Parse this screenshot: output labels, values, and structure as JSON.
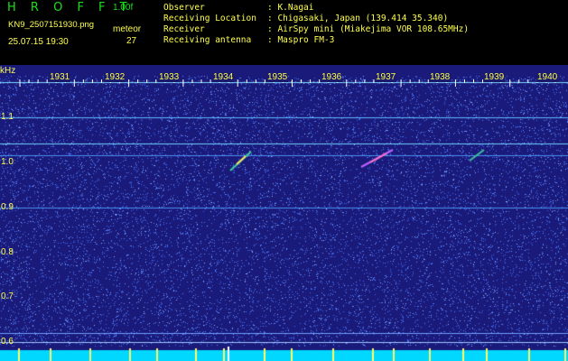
{
  "header": {
    "title": "H R O F F T",
    "version": "1.00f",
    "filename": "KN9_2507151930.png",
    "timestamp": "25.07.15 19:30",
    "meteor_label": "meteor",
    "meteor_count": "27",
    "info": [
      {
        "label": "Observer",
        "value": ": K.Nagai"
      },
      {
        "label": "Receiving Location",
        "value": ": Chigasaki, Japan (139.414 35.340)"
      },
      {
        "label": "Receiver",
        "value": ": AirSpy mini (Miakejima VOR 108.65MHz)"
      },
      {
        "label": "Receiving antenna",
        "value": ": Maspro FM-3"
      }
    ]
  },
  "axis": {
    "unit": "kHz",
    "y_ticks": [
      "1.1",
      "1.0",
      "0.9",
      "0.8",
      "0.7",
      "0.6"
    ],
    "minutes": [
      "1931",
      "1932",
      "1933",
      "1934",
      "1935",
      "1936",
      "1937",
      "1938",
      "1939",
      "1940"
    ]
  },
  "colors": {
    "background": "#1a1a7a",
    "noise": "#4a7bff",
    "text": "#ffff4d",
    "title": "#19e019",
    "bottom_bar": "#00d8ff"
  }
}
